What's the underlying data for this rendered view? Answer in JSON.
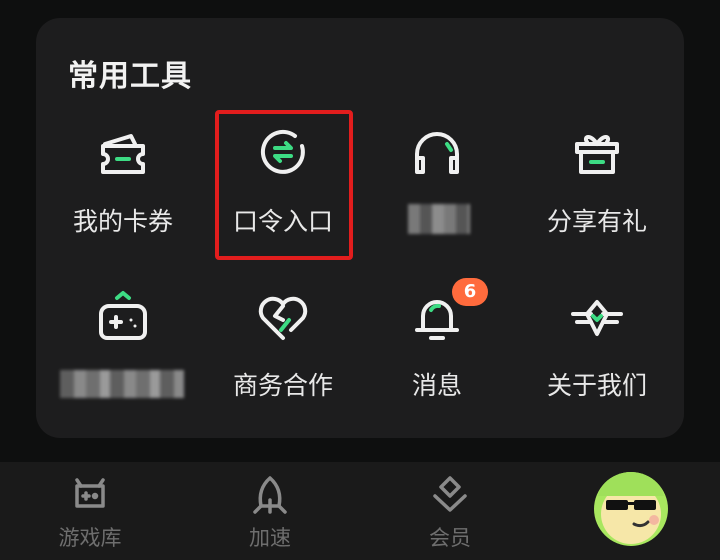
{
  "section": {
    "title": "常用工具"
  },
  "tools": [
    {
      "label": "我的卡券",
      "icon": "coupon-ticket-icon"
    },
    {
      "label": "口令入口",
      "icon": "code-exchange-icon"
    },
    {
      "label": "",
      "icon": "headset-support-icon",
      "label_obscured": true
    },
    {
      "label": "分享有礼",
      "icon": "gift-box-icon"
    },
    {
      "label": "",
      "icon": "gamepad-icon",
      "label_obscured": true
    },
    {
      "label": "商务合作",
      "icon": "heart-handshake-icon"
    },
    {
      "label": "消息",
      "icon": "bell-icon",
      "badge": "6"
    },
    {
      "label": "关于我们",
      "icon": "wings-logo-icon"
    }
  ],
  "tabbar": {
    "items": [
      {
        "label": "游戏库",
        "icon": "game-library-icon"
      },
      {
        "label": "加速",
        "icon": "rocket-boost-icon"
      },
      {
        "label": "会员",
        "icon": "vip-diamond-icon"
      },
      {
        "label": "",
        "icon": "avatar"
      }
    ]
  },
  "colors": {
    "background": "#0e0f0f",
    "card": "#1d1d1e",
    "accent_green": "#3ddc84",
    "highlight_red": "#e21d1d",
    "badge_orange": "#ff6b3d"
  }
}
